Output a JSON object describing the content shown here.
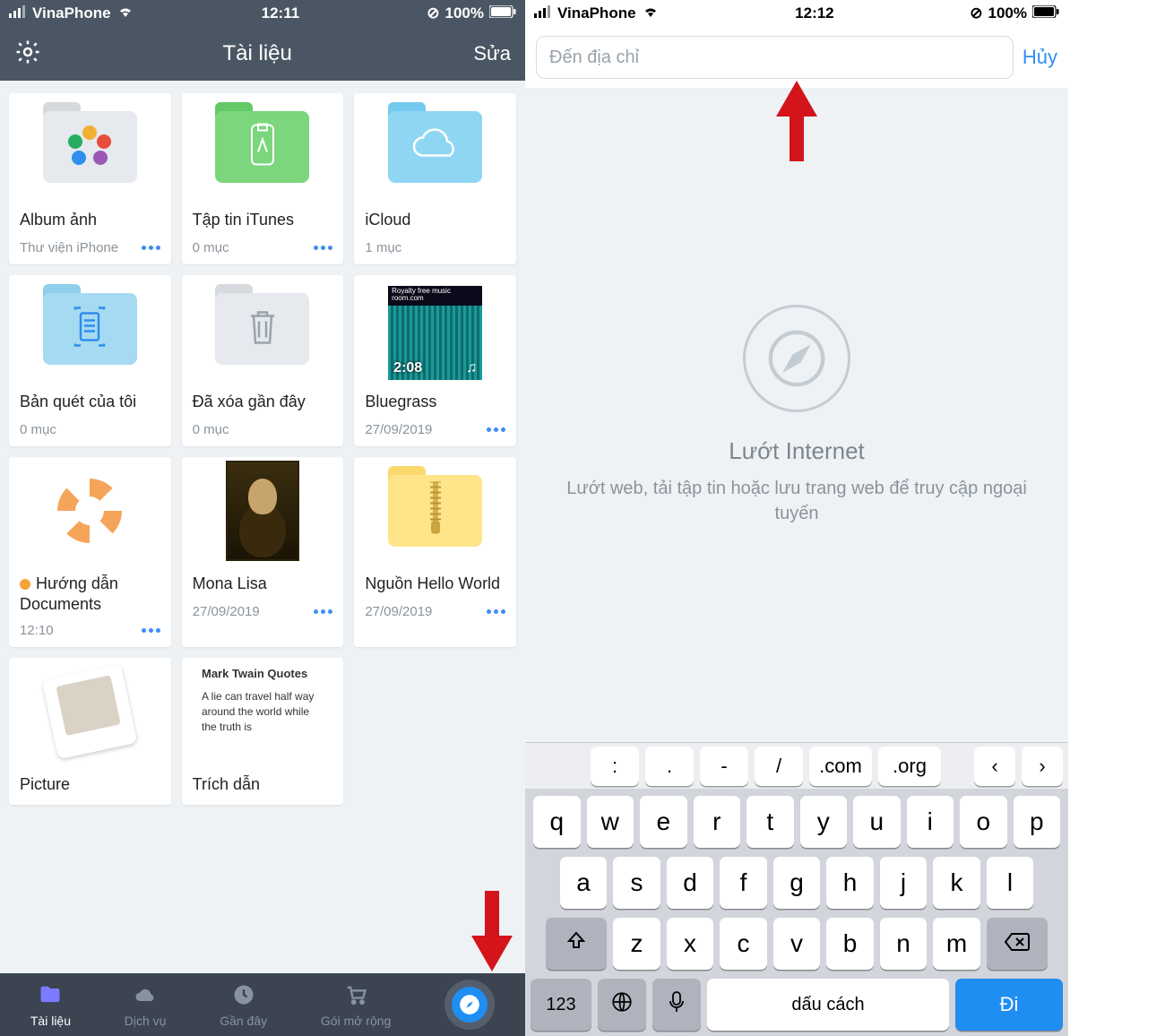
{
  "left": {
    "status": {
      "carrier": "VinaPhone",
      "time": "12:11",
      "battery": "100%"
    },
    "header": {
      "title": "Tài liệu",
      "edit": "Sửa"
    },
    "tiles": [
      {
        "title": "Album ảnh",
        "sub": "Thư viện iPhone",
        "more": true
      },
      {
        "title": "Tập tin iTunes",
        "sub": "0 mục",
        "more": true
      },
      {
        "title": "iCloud",
        "sub": "1 mục",
        "more": false
      },
      {
        "title": "Bản quét của tôi",
        "sub": "0 mục",
        "more": false
      },
      {
        "title": "Đã xóa gần đây",
        "sub": "0 mục",
        "more": false
      },
      {
        "title": "Bluegrass",
        "sub": "27/09/2019",
        "more": true,
        "duration": "2:08",
        "thumbText1": "Royalty free music room.com"
      },
      {
        "title": "Hướng dẫn Documents",
        "sub": "12:10",
        "more": true,
        "dot": true
      },
      {
        "title": "Mona Lisa",
        "sub": "27/09/2019",
        "more": true
      },
      {
        "title": "Nguồn Hello World",
        "sub": "27/09/2019",
        "more": true
      },
      {
        "title": "Picture",
        "sub": "",
        "more": false
      },
      {
        "title": "Trích dẫn",
        "sub": "",
        "more": false,
        "quoteTitle": "Mark Twain Quotes",
        "quoteText": "A lie can travel half way around the world while the truth is"
      }
    ],
    "tabs": {
      "t1": "Tài liệu",
      "t2": "Dịch vụ",
      "t3": "Gần đây",
      "t4": "Gói mở rộng"
    }
  },
  "right": {
    "status": {
      "carrier": "VinaPhone",
      "time": "12:12",
      "battery": "100%"
    },
    "addr": {
      "placeholder": "Đến địa chỉ",
      "cancel": "Hủy"
    },
    "empty": {
      "title": "Lướt Internet",
      "sub": "Lướt web, tải tập tin hoặc lưu trang web để truy cập ngoại tuyến"
    },
    "kbd": {
      "acc": [
        ":",
        ".",
        "-",
        "/",
        ".com",
        ".org"
      ],
      "row1": [
        "q",
        "w",
        "e",
        "r",
        "t",
        "y",
        "u",
        "i",
        "o",
        "p"
      ],
      "row2": [
        "a",
        "s",
        "d",
        "f",
        "g",
        "h",
        "j",
        "k",
        "l"
      ],
      "row3": [
        "z",
        "x",
        "c",
        "v",
        "b",
        "n",
        "m"
      ],
      "num": "123",
      "space": "dấu cách",
      "go": "Đi"
    }
  }
}
